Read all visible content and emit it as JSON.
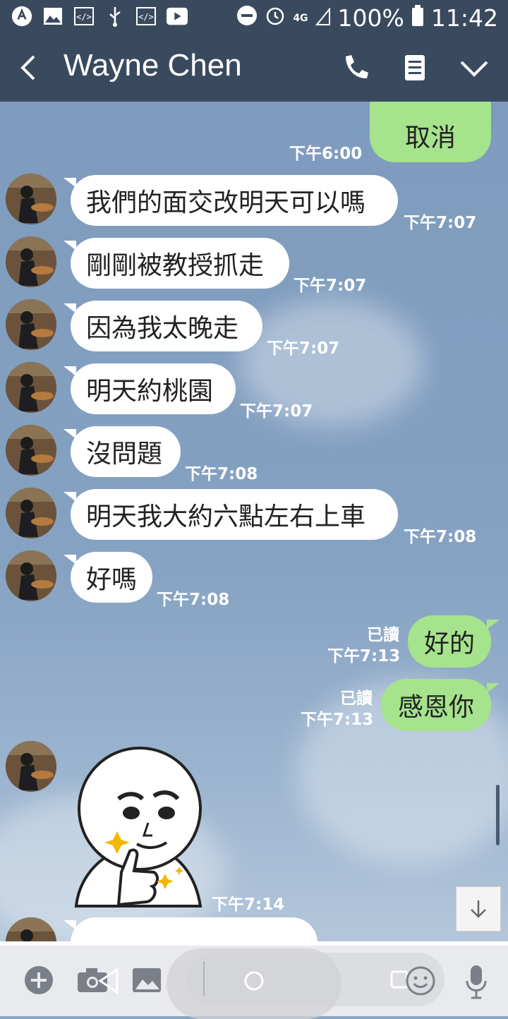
{
  "status_bar": {
    "network": "4G",
    "battery": "100%",
    "time": "11:42"
  },
  "header": {
    "contact_name": "Wayne Chen",
    "icons": [
      "back-icon",
      "phone-icon",
      "note-icon",
      "chevron-down-icon"
    ]
  },
  "messages": [
    {
      "side": "out",
      "text": "取消",
      "time": "下午6:00"
    },
    {
      "side": "in",
      "text": "我們的面交改明天可以嗎",
      "time": "下午7:07"
    },
    {
      "side": "in",
      "text": "剛剛被教授抓走",
      "time": "下午7:07"
    },
    {
      "side": "in",
      "text": "因為我太晚走",
      "time": "下午7:07"
    },
    {
      "side": "in",
      "text": "明天約桃園",
      "time": "下午7:07"
    },
    {
      "side": "in",
      "text": "沒問題",
      "time": "下午7:08"
    },
    {
      "side": "in",
      "text": "明天我大約六點左右上車",
      "time": "下午7:08"
    },
    {
      "side": "in",
      "text": "好嗎",
      "time": "下午7:08"
    },
    {
      "side": "out",
      "text": "好的",
      "read": "已讀",
      "time": "下午7:13"
    },
    {
      "side": "out",
      "text": "感恩你",
      "read": "已讀",
      "time": "下午7:13"
    },
    {
      "side": "in",
      "sticker": "thumbs-up-character-sticker",
      "time": "下午7:14"
    }
  ],
  "colors": {
    "header_bg": "#3a4a5e",
    "outgoing_bubble": "#a6e38d",
    "incoming_bubble": "#ffffff",
    "chat_bg": "#86a2c2"
  },
  "input_bar": {
    "icons": [
      "plus-icon",
      "camera-icon",
      "image-icon",
      "emoji-icon",
      "microphone-icon"
    ]
  }
}
